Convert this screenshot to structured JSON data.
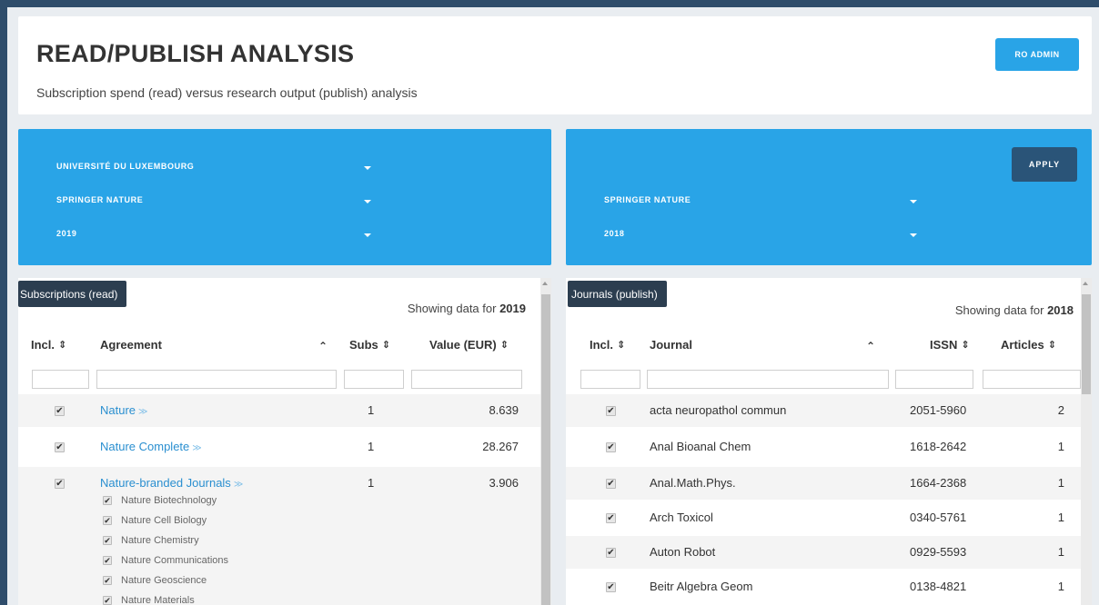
{
  "header": {
    "title": "READ/PUBLISH ANALYSIS",
    "subtitle": "Subscription spend (read) versus research output (publish) analysis",
    "admin_label": "RO ADMIN"
  },
  "read_filters": {
    "institution": "UNIVERSITÉ DU LUXEMBOURG",
    "publisher": "SPRINGER NATURE",
    "year": "2019"
  },
  "publish_filters": {
    "apply_label": "APPLY",
    "publisher": "SPRINGER NATURE",
    "year": "2018"
  },
  "read_table": {
    "tab_label": "Subscriptions (read)",
    "showing_prefix": "Showing data for",
    "showing_year": "2019",
    "columns": {
      "incl": "Incl.",
      "agreement": "Agreement",
      "subs": "Subs",
      "value": "Value (EUR)"
    },
    "rows": [
      {
        "agreement": "Nature",
        "subs": "1",
        "value": "8.639",
        "included": true
      },
      {
        "agreement": "Nature Complete",
        "subs": "1",
        "value": "28.267",
        "included": true
      },
      {
        "agreement": "Nature-branded Journals",
        "subs": "1",
        "value": "3.906",
        "included": true,
        "titles": [
          "Nature Biotechnology",
          "Nature Cell Biology",
          "Nature Chemistry",
          "Nature Communications",
          "Nature Geoscience",
          "Nature Materials"
        ]
      }
    ]
  },
  "publish_table": {
    "tab_label": "Journals (publish)",
    "showing_prefix": "Showing data for",
    "showing_year": "2018",
    "columns": {
      "incl": "Incl.",
      "journal": "Journal",
      "issn": "ISSN",
      "articles": "Articles"
    },
    "rows": [
      {
        "journal": "acta neuropathol commun",
        "issn": "2051-5960",
        "articles": "2",
        "included": true
      },
      {
        "journal": "Anal Bioanal Chem",
        "issn": "1618-2642",
        "articles": "1",
        "included": true
      },
      {
        "journal": "Anal.Math.Phys.",
        "issn": "1664-2368",
        "articles": "1",
        "included": true
      },
      {
        "journal": "Arch Toxicol",
        "issn": "0340-5761",
        "articles": "1",
        "included": true
      },
      {
        "journal": "Auton Robot",
        "issn": "0929-5593",
        "articles": "1",
        "included": true
      },
      {
        "journal": "Beitr Algebra Geom",
        "issn": "0138-4821",
        "articles": "1",
        "included": true
      }
    ]
  },
  "colors": {
    "accent": "#29a4e7",
    "dark": "#2c3e50",
    "link": "#2a8fd0",
    "apply": "#2a5478"
  }
}
